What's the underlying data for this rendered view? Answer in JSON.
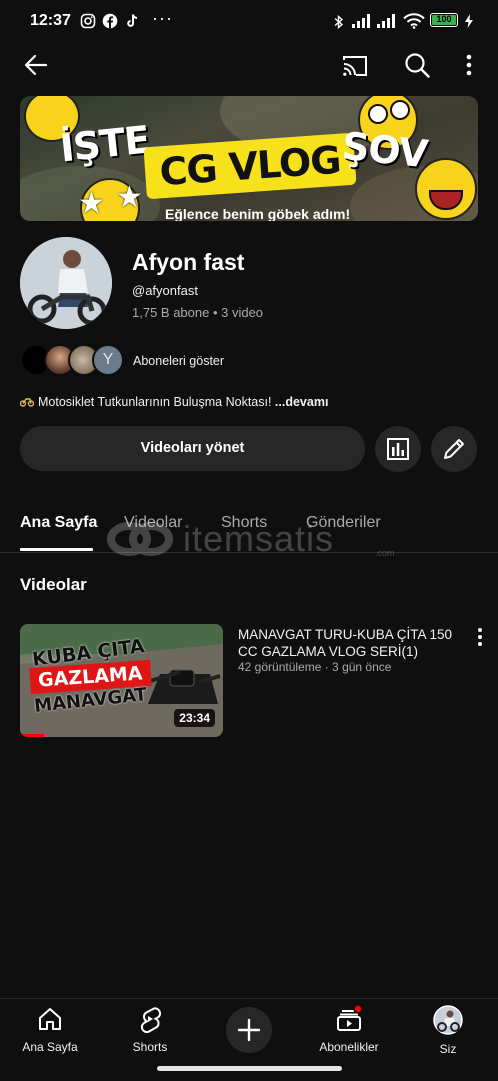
{
  "status": {
    "time": "12:37",
    "dots": "···",
    "battery": "100"
  },
  "banner": {
    "left_text": "İŞTE",
    "middle_text": "CG VLOG",
    "right_text": "ŞOV",
    "tagline": "Eğlence benim göbek adım!"
  },
  "channel": {
    "name": "Afyon fast",
    "handle": "@afyonfast",
    "stats": "1,75 B abone • 3 video",
    "subscriber_avatar_letter": "Y",
    "show_subscribers": "Aboneleri göster",
    "description": "Motosiklet Tutkunlarının Buluşma Noktası!",
    "description_more": "...devamı",
    "manage_videos": "Videoları yönet"
  },
  "tabs": [
    {
      "label": "Ana Sayfa",
      "active": true
    },
    {
      "label": "Videolar",
      "active": false
    },
    {
      "label": "Shorts",
      "active": false
    },
    {
      "label": "Gönderiler",
      "active": false
    }
  ],
  "section": {
    "title": "Videolar"
  },
  "watermark": {
    "brand": "itemsatis",
    "suffix": ".com"
  },
  "video": {
    "thumb_line1": "KUBA ÇITA",
    "thumb_line2": "GAZLAMA",
    "thumb_line3": "MANAVGAT",
    "duration": "23:34",
    "watched_fraction": 0.12,
    "title": "MANAVGAT TURU-KUBA ÇİTA 150 CC GAZLAMA VLOG SERİ(1)",
    "meta": "42 görüntüleme · 3 gün önce"
  },
  "nav": [
    {
      "label": "Ana Sayfa",
      "icon": "home-icon"
    },
    {
      "label": "Shorts",
      "icon": "shorts-icon"
    },
    {
      "label": "",
      "icon": "create-icon"
    },
    {
      "label": "Abonelikler",
      "icon": "subscriptions-icon"
    },
    {
      "label": "Siz",
      "icon": "profile-avatar"
    }
  ],
  "colors": {
    "background": "#0f0f0f",
    "surface": "#272727",
    "accent_red": "#ff0000",
    "banner_yellow": "#f7e11b",
    "battery_green": "#37b24d"
  }
}
